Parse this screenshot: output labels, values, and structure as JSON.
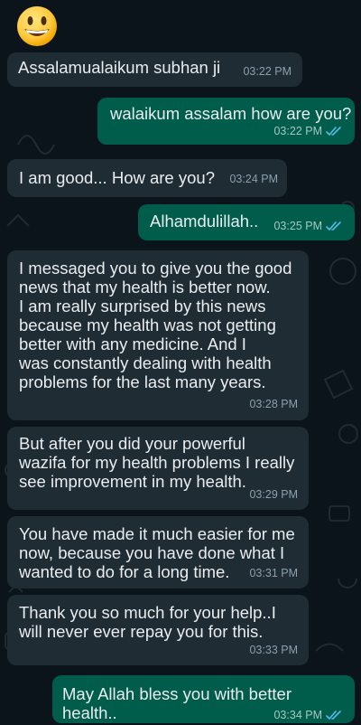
{
  "emoji": "smiling-face-icon",
  "colors": {
    "background": "#0b141a",
    "incoming": "#1f2c34",
    "outgoing": "#005c4b",
    "read_ticks": "#53bdeb"
  },
  "messages": [
    {
      "dir": "in",
      "lines": [
        "Assalamualaikum subhan ji"
      ],
      "time": "03:22 PM"
    },
    {
      "dir": "out",
      "lines": [
        "walaikum assalam how are you?"
      ],
      "time": "03:22 PM"
    },
    {
      "dir": "in",
      "lines": [
        "I am good... How are you?"
      ],
      "time": "03:24 PM"
    },
    {
      "dir": "out",
      "lines": [
        "Alhamdulillah.."
      ],
      "time": "03:25 PM"
    },
    {
      "dir": "in",
      "lines": [
        "I messaged you to give you the good",
        "news that my health is better now.",
        "I am really surprised by this news",
        "because my health was not getting",
        "better with any medicine. And I",
        "was constantly dealing with health",
        "problems for the last many years."
      ],
      "time": "03:28 PM"
    },
    {
      "dir": "in",
      "lines": [
        "But after you did your powerful",
        "wazifa for my health problems I really",
        "see improvement in my health."
      ],
      "time": "03:29 PM"
    },
    {
      "dir": "in",
      "lines": [
        "You have made it much easier for me",
        "now, because you have done what I",
        "wanted to do for a long time."
      ],
      "time": "03:31 PM"
    },
    {
      "dir": "in",
      "lines": [
        "Thank you so much for your help..I",
        "will never ever repay you for this."
      ],
      "time": "03:33 PM"
    },
    {
      "dir": "out",
      "lines": [
        "May Allah bless you with better",
        "health.."
      ],
      "time": "03:34 PM"
    }
  ]
}
